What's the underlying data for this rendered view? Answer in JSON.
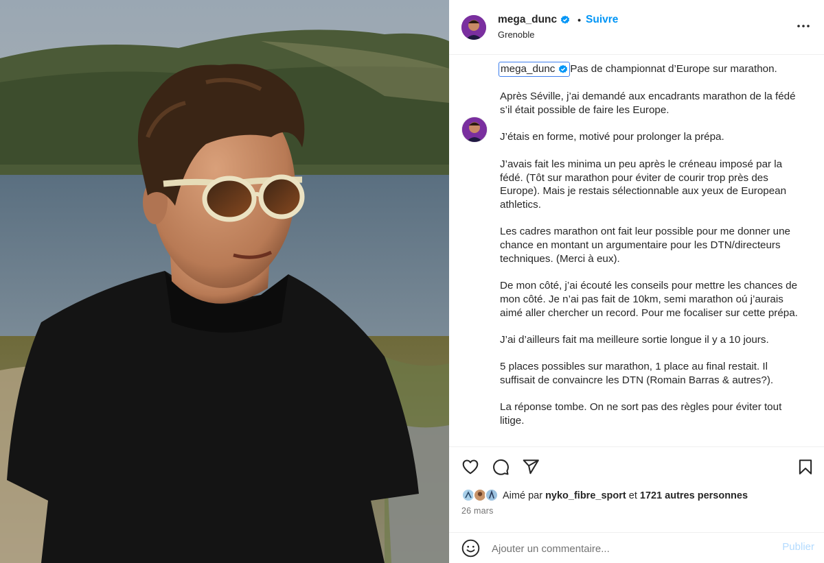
{
  "post": {
    "username": "mega_dunc",
    "follow_label": "Suivre",
    "separator": "•",
    "location": "Grenoble",
    "more_icon": "more-horizontal-icon",
    "verified_icon": "verified-badge-icon",
    "accent_color": "#0095f6"
  },
  "caption": {
    "username": "mega_dunc",
    "first_line": "Pas de championnat d’Europe sur marathon.",
    "paragraphs": [
      "Après Séville, j’ai demandé aux encadrants marathon de la fédé s’il était possible de faire les Europe.",
      "J’étais en forme, motivé pour prolonger la prépa.",
      "J’avais fait les minima un peu après le créneau imposé par la fédé. (Tôt sur marathon pour éviter de courir trop près des Europe). Mais je restais sélectionnable aux yeux de European athletics.",
      "Les cadres marathon ont fait leur possible pour me donner une chance en montant un argumentaire pour les DTN/directeurs techniques. (Merci à eux).",
      "De mon côté, j’ai écouté les conseils pour mettre les chances de mon côté. Je n’ai pas fait de 10km, semi marathon oú j’aurais aimé aller chercher un record. Pour me focaliser sur cette prépa.",
      "J’ai d’ailleurs fait ma meilleure sortie longue il y a 10 jours.",
      "5 places possibles sur marathon, 1 place au final restait. Il suffisait de convaincre les DTN (Romain Barras & autres?).",
      "La réponse tombe. On ne sort pas des règles pour éviter tout litige."
    ]
  },
  "actions": {
    "like_icon": "heart-icon",
    "comment_icon": "comment-bubble-icon",
    "share_icon": "paper-plane-icon",
    "save_icon": "bookmark-icon"
  },
  "likes": {
    "prefix": "Aimé par",
    "user": "nyko_fibre_sport",
    "connector": "et",
    "others": "1721 autres personnes"
  },
  "date": "26 mars",
  "comment_box": {
    "emoji_icon": "smiley-icon",
    "placeholder": "Ajouter un commentaire...",
    "publish_label": "Publier"
  }
}
